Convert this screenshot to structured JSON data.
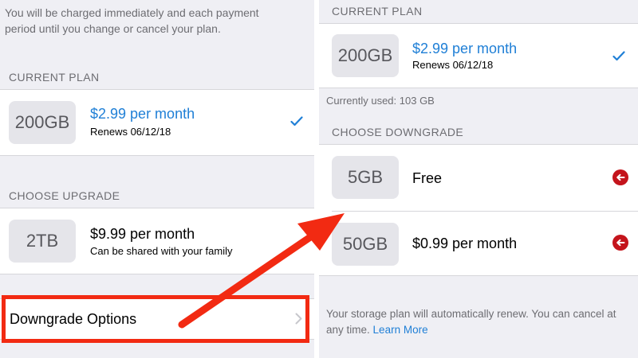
{
  "left": {
    "intro_text": "You will be charged immediately and each payment period until you change or cancel your plan.",
    "current_plan_header": "CURRENT PLAN",
    "current_plan": {
      "size": "200GB",
      "price": "$2.99 per month",
      "renews": "Renews 06/12/18"
    },
    "upgrade_header": "CHOOSE UPGRADE",
    "upgrade_option": {
      "size": "2TB",
      "price": "$9.99 per month",
      "note": "Can be shared with your family"
    },
    "downgrade_options_label": "Downgrade Options"
  },
  "right": {
    "current_plan_header": "CURRENT PLAN",
    "current_plan": {
      "size": "200GB",
      "price": "$2.99 per month",
      "renews": "Renews 06/12/18"
    },
    "currently_used": "Currently used: 103 GB",
    "downgrade_header": "CHOOSE DOWNGRADE",
    "options": [
      {
        "size": "5GB",
        "price": "Free"
      },
      {
        "size": "50GB",
        "price": "$0.99 per month"
      }
    ],
    "footer_text": "Your storage plan will automatically renew. You can cancel at any time.",
    "learn_more": "Learn More"
  },
  "colors": {
    "accent_blue": "#1f7fd6",
    "annotation_red": "#f22a12",
    "delete_red": "#c4141c",
    "group_background": "#efeff4"
  },
  "icons": {
    "check": "checkmark-icon",
    "chevron": "chevron-right-icon",
    "delete": "delete-minus-icon",
    "arrow": "annotation-arrow"
  }
}
